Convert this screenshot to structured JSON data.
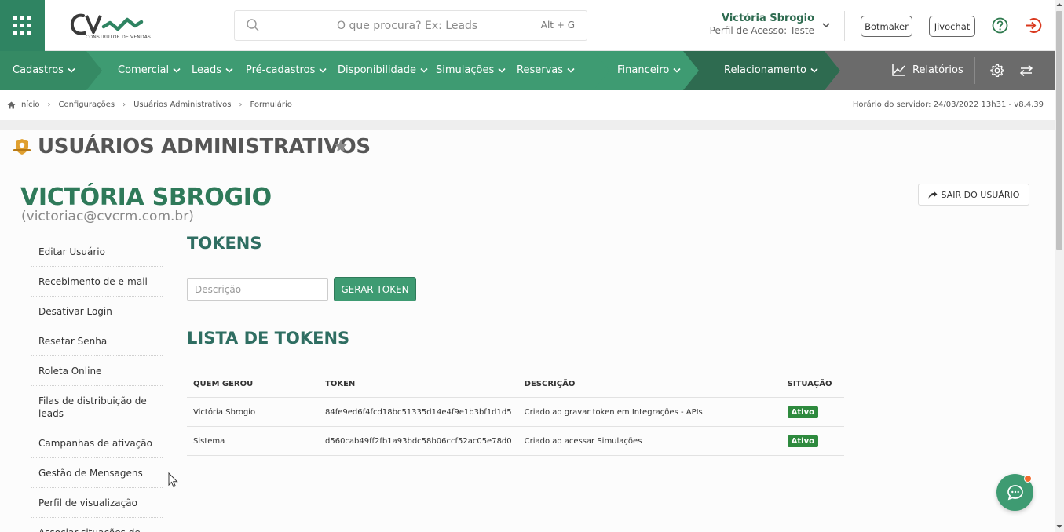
{
  "header": {
    "logo_sub": "CONSTRUTOR DE VENDAS",
    "search_placeholder": "O que procura? Ex: Leads",
    "search_shortcut": "Alt + G",
    "user_name": "Victória Sbrogio",
    "user_profile": "Perfil de Acesso: Teste",
    "botmaker_label": "Botmaker",
    "jivochat_label": "Jivochat"
  },
  "nav": {
    "items": [
      {
        "label": "Cadastros"
      },
      {
        "label": "Comercial"
      },
      {
        "label": "Leads"
      },
      {
        "label": "Pré-cadastros"
      },
      {
        "label": "Disponibilidade"
      },
      {
        "label": "Simulações"
      },
      {
        "label": "Reservas"
      },
      {
        "label": "Financeiro"
      },
      {
        "label": "Relacionamento"
      }
    ],
    "reports_label": "Relatórios",
    "colors": {
      "bar": "#3e9b72",
      "dark": "#2e6b50",
      "gray": "#6b6b6b"
    }
  },
  "breadcrumb": {
    "items": [
      "Início",
      "Configurações",
      "Usuários Administrativos",
      "Formulário"
    ],
    "server_time": "Horário do servidor: 24/03/2022 13h31 - v8.4.39"
  },
  "page": {
    "title": "USUÁRIOS ADMINISTRATIVOS",
    "person_name": "VICTÓRIA SBROGIO",
    "person_email": "(victoriac@cvcrm.com.br)",
    "exit_user_label": "SAIR DO USUÁRIO"
  },
  "side_menu": [
    "Editar Usuário",
    "Recebimento de e-mail",
    "Desativar Login",
    "Resetar Senha",
    "Roleta Online",
    "Filas de distribuição de leads",
    "Campanhas de ativação",
    "Gestão de Mensagens",
    "Perfil de visualização",
    "Associar situações de"
  ],
  "tokens": {
    "title": "TOKENS",
    "description_placeholder": "Descrição",
    "generate_label": "GERAR TOKEN",
    "list_title": "LISTA DE TOKENS",
    "columns": [
      "QUEM GEROU",
      "TOKEN",
      "DESCRIÇÃO",
      "SITUAÇÃO"
    ],
    "rows": [
      {
        "who": "Victória Sbrogio",
        "token": "84fe9ed6f4fcd18bc51335d14e4f9e1b3bf1d1d5",
        "description": "Criado ao gravar token em Integrações - APIs",
        "status": "Ativo"
      },
      {
        "who": "Sistema",
        "token": "d560cab49ff2fb1a93bdc58b06ccf52ac05e78d0",
        "description": "Criado ao acessar Simulações",
        "status": "Ativo"
      }
    ]
  }
}
